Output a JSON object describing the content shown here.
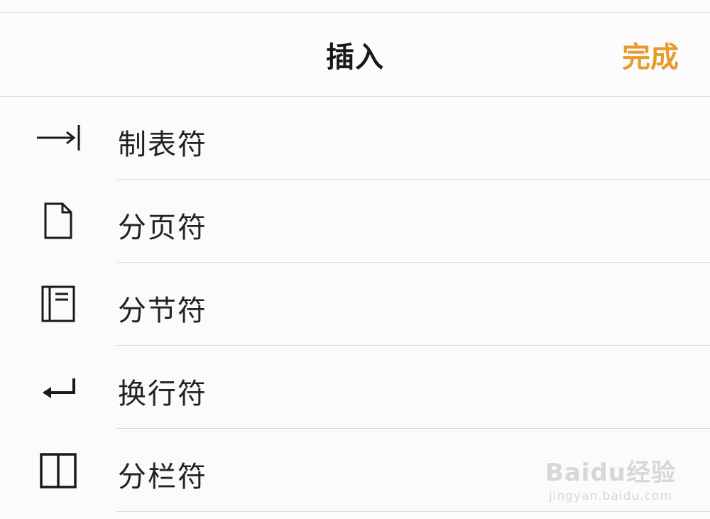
{
  "nav": {
    "title": "插入",
    "done_label": "完成",
    "accent_color": "#e89a2c"
  },
  "items": [
    {
      "label": "制表符",
      "icon": "tab-arrow-icon"
    },
    {
      "label": "分页符",
      "icon": "page-icon"
    },
    {
      "label": "分节符",
      "icon": "section-icon"
    },
    {
      "label": "换行符",
      "icon": "return-arrow-icon"
    },
    {
      "label": "分栏符",
      "icon": "columns-icon"
    }
  ],
  "watermark": {
    "brand": "Baidu经验",
    "url": "jingyan.baidu.com"
  }
}
